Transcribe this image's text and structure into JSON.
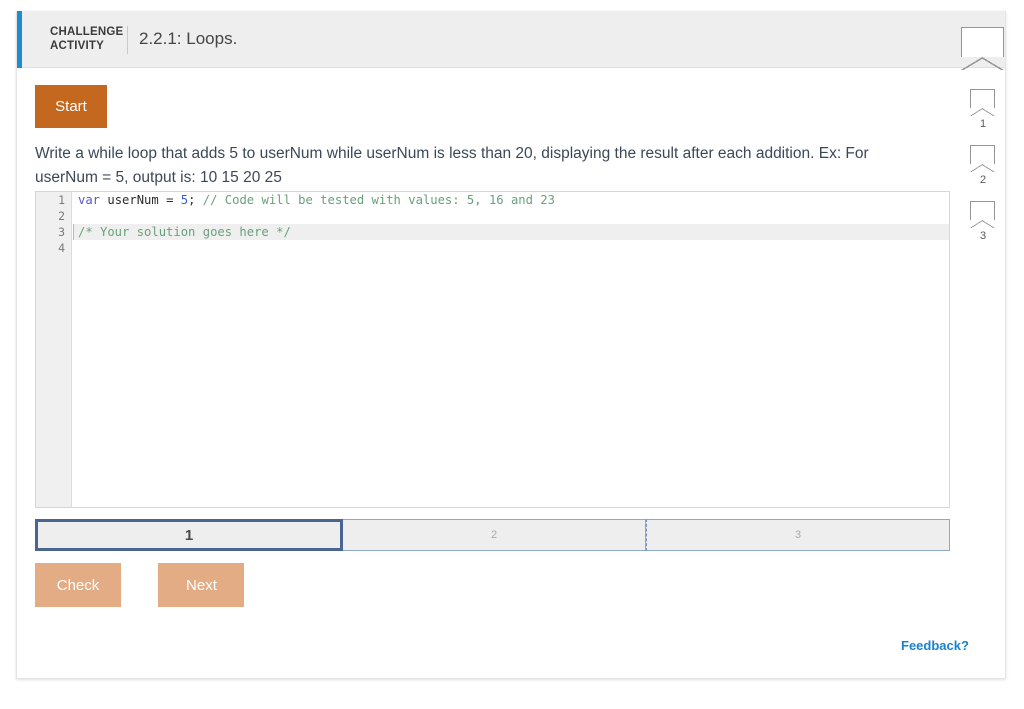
{
  "header": {
    "kicker": "CHALLENGE ACTIVITY",
    "title": "2.2.1: Loops.",
    "accent_color": "#1f8ccd",
    "background": "#eeeeee"
  },
  "progress_badges": [
    {
      "label": "1"
    },
    {
      "label": "2"
    },
    {
      "label": "3"
    }
  ],
  "toolbar": {
    "start_label": "Start",
    "start_color": "#c4671f"
  },
  "prompt": {
    "text": "Write a while loop that adds 5 to userNum while userNum is less than 20, displaying the result after each addition. Ex: For userNum = 5, output is: 10 15 20 25"
  },
  "editor": {
    "gutter": [
      "1",
      "2",
      "3",
      "4"
    ],
    "active_line": 3,
    "lines": [
      {
        "number": "1",
        "tokens": [
          {
            "text": "var",
            "type": "keyword"
          },
          {
            "text": " userNum ",
            "type": "identifier"
          },
          {
            "text": "= ",
            "type": "operator"
          },
          {
            "text": "5",
            "type": "number"
          },
          {
            "text": "; ",
            "type": "operator"
          },
          {
            "text": "// Code will be tested with values: 5, 16 and 23",
            "type": "comment"
          }
        ]
      },
      {
        "number": "2",
        "tokens": []
      },
      {
        "number": "3",
        "tokens": [
          {
            "text": "/* Your solution goes here */",
            "type": "comment"
          }
        ]
      },
      {
        "number": "4",
        "tokens": []
      }
    ],
    "colors": {
      "keyword": "#5b57c9",
      "number": "#2f5fe0",
      "comment": "#69a07c",
      "active_line_bg": "#efefef"
    }
  },
  "step_tabs": {
    "items": [
      {
        "label": "1",
        "active": true
      },
      {
        "label": "2",
        "active": false
      },
      {
        "label": "3",
        "active": false
      }
    ],
    "active_border_color": "#4a6591",
    "inactive_border_color": "#8fa9c4"
  },
  "actions": {
    "check_label": "Check",
    "next_label": "Next",
    "button_color": "#e4ac85"
  },
  "feedback": {
    "label": "Feedback?",
    "color": "#1a83cd"
  }
}
